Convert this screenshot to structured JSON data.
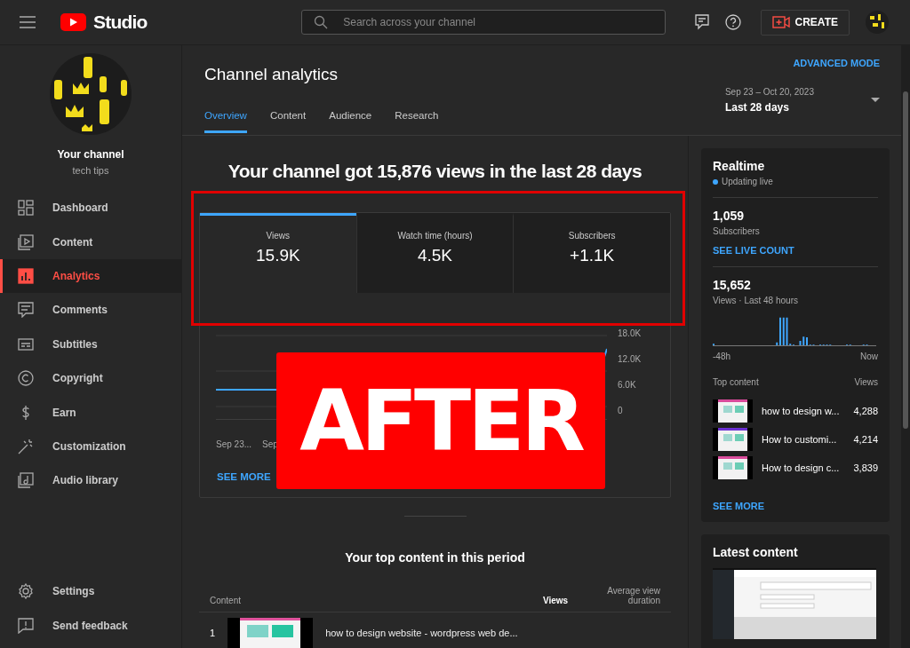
{
  "topbar": {
    "logo_text": "Studio",
    "search": {
      "placeholder": "Search across your channel"
    },
    "create_button": "CREATE"
  },
  "sidebar": {
    "channel_name": "Your channel",
    "channel_subtitle": "tech tips",
    "items": [
      {
        "label": "Dashboard",
        "kind": "dashboard",
        "selected": false
      },
      {
        "label": "Content",
        "kind": "content",
        "selected": false
      },
      {
        "label": "Analytics",
        "kind": "analytics",
        "selected": true
      },
      {
        "label": "Comments",
        "kind": "comments",
        "selected": false
      },
      {
        "label": "Subtitles",
        "kind": "subtitles",
        "selected": false
      },
      {
        "label": "Copyright",
        "kind": "copyright",
        "selected": false
      },
      {
        "label": "Earn",
        "kind": "earn",
        "selected": false
      },
      {
        "label": "Customization",
        "kind": "customization",
        "selected": false
      },
      {
        "label": "Audio library",
        "kind": "audio",
        "selected": false
      }
    ],
    "footer_items": [
      {
        "label": "Settings",
        "kind": "settings"
      },
      {
        "label": "Send feedback",
        "kind": "feedback"
      }
    ]
  },
  "header": {
    "title": "Channel analytics",
    "advanced_mode": "ADVANCED MODE",
    "tabs": [
      {
        "label": "Overview",
        "selected": true
      },
      {
        "label": "Content",
        "selected": false
      },
      {
        "label": "Audience",
        "selected": false
      },
      {
        "label": "Research",
        "selected": false
      }
    ],
    "date_range": {
      "dates": "Sep 23 – Oct 20, 2023",
      "period": "Last 28 days"
    }
  },
  "overview": {
    "headline": "Your channel got 15,876 views in the last 28 days",
    "metrics": [
      {
        "label": "Views",
        "value": "15.9K",
        "selected": true
      },
      {
        "label": "Watch time (hours)",
        "value": "4.5K",
        "selected": false
      },
      {
        "label": "Subscribers",
        "value": "+1.1K",
        "selected": false
      }
    ],
    "chart": {
      "y_ticks": [
        "18.0K",
        "12.0K",
        "6.0K",
        "0"
      ],
      "x_labels": [
        "Sep 23...",
        "Sep"
      ]
    },
    "see_more": "SEE MORE",
    "overlay": {
      "text": "AFTER"
    }
  },
  "top_content": {
    "title": "Your top content in this period",
    "columns": [
      "Content",
      "Views",
      "Average view duration"
    ],
    "rows": [
      {
        "rank": "1",
        "title": "how to design website - wordpress web de..."
      }
    ]
  },
  "realtime": {
    "title": "Realtime",
    "status": "Updating live",
    "subscribers": "1,059",
    "subscribers_label": "Subscribers",
    "live_count": "SEE LIVE COUNT",
    "views": "15,652",
    "views_label": "Views · Last 48 hours",
    "axis_start": "-48h",
    "axis_end": "Now",
    "top_label": "Top content",
    "views_header": "Views",
    "top": [
      {
        "title": "how to design w...",
        "views": "4,288"
      },
      {
        "title": "How to customi...",
        "views": "4,214"
      },
      {
        "title": "How to design c...",
        "views": "3,839"
      }
    ],
    "see_more": "SEE MORE"
  },
  "latest": {
    "title": "Latest content"
  }
}
